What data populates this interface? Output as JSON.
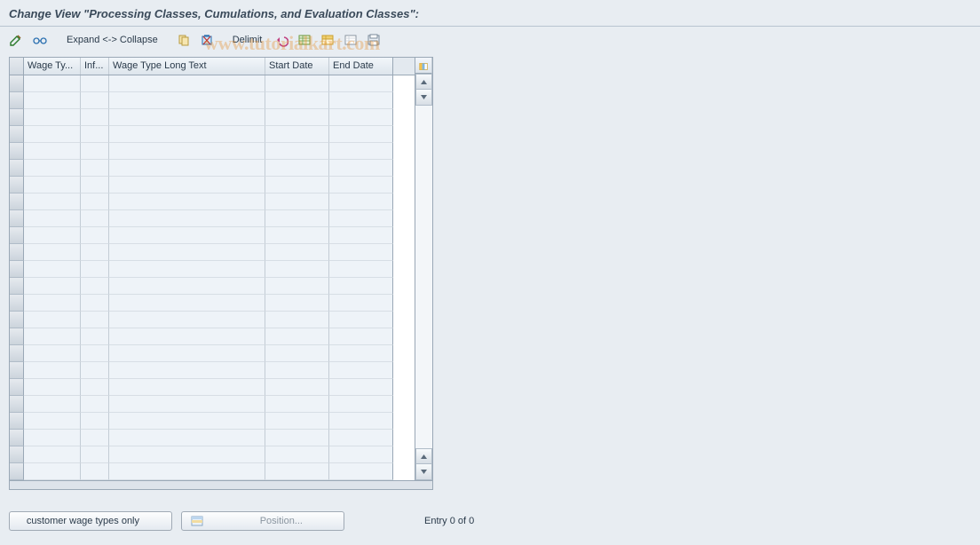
{
  "header": {
    "title": "Change View \"Processing Classes, Cumulations, and Evaluation Classes\":"
  },
  "toolbar": {
    "expand_label": "Expand <-> Collapse",
    "delimit_label": "Delimit"
  },
  "watermark": "www.tutorialkart.com",
  "table": {
    "columns": {
      "c1": "Wage Ty...",
      "c2": "Inf...",
      "c3": "Wage Type Long Text",
      "c4": "Start Date",
      "c5": "End Date"
    },
    "rows": []
  },
  "footer": {
    "customer_btn": "customer wage types only",
    "position_btn": "Position...",
    "status": "Entry 0 of 0"
  }
}
